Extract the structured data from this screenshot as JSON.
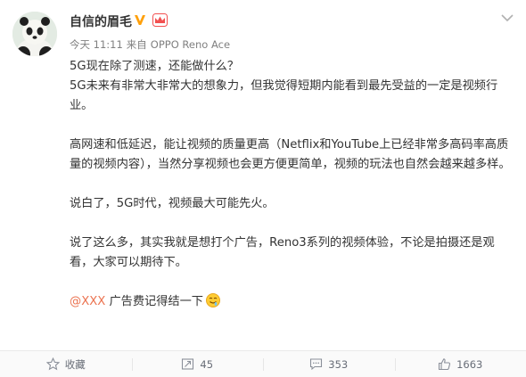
{
  "post": {
    "author": {
      "name": "自信的眉毛",
      "avatar_icon": "panda-avatar"
    },
    "meta": {
      "time": "今天 11:11",
      "source_prefix": "来自",
      "device": "OPPO Reno Ace"
    },
    "body": {
      "line1": "5G现在除了测速，还能做什么？",
      "line2": "5G未来有非常大非常大的想象力，但我觉得短期内能看到最先受益的一定是视频行业。",
      "para2": "高网速和低延迟，能让视频的质量更高（Netflix和YouTube上已经非常多高码率高质量的视频内容），当然分享视频也会更方便更简单，视频的玩法也自然会越来越多样。",
      "para3": "说白了，5G时代，视频最大可能先火。",
      "para4": "说了这么多，其实我就是想打个广告，Reno3系列的视频体验，不论是拍摄还是观看，大家可以期待下。",
      "mention": "@XXX",
      "closing": " 广告费记得结一下"
    }
  },
  "actions": {
    "favorite": {
      "label": "收藏",
      "icon": "star-icon"
    },
    "repost": {
      "label": "45",
      "icon": "repost-icon"
    },
    "comment": {
      "label": "353",
      "icon": "comment-icon"
    },
    "like": {
      "label": "1663",
      "icon": "thumbs-up-icon"
    }
  },
  "colors": {
    "mention": "#eb7350",
    "badge": "#ffa00a",
    "secondary_text": "#808080"
  }
}
